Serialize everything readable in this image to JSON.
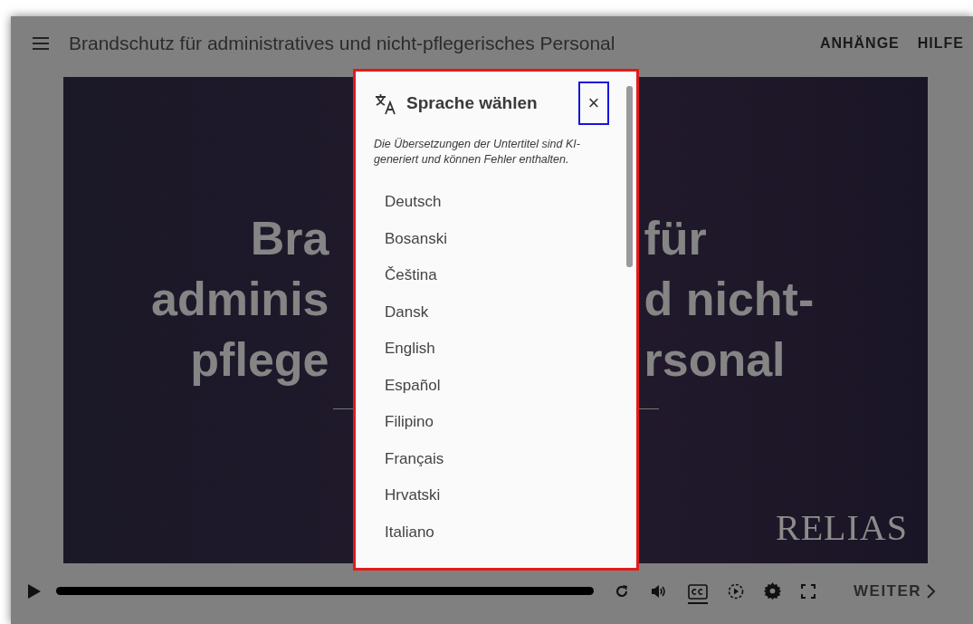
{
  "header": {
    "title": "Brandschutz für administratives und nicht-pflegerisches Personal",
    "links": [
      "ANHÄNGE",
      "HILFE"
    ]
  },
  "slide": {
    "title_lines": [
      {
        "left": "Bra",
        "right": "für"
      },
      {
        "left": "adminis",
        "right": "d nicht-"
      },
      {
        "left": "pflege",
        "right": "rsonal"
      }
    ],
    "logo": "RELIAS"
  },
  "dialog": {
    "title": "Sprache wählen",
    "note": "Die Übersetzungen der Untertitel sind KI-generiert und können Fehler enthalten.",
    "close": "×",
    "languages": [
      {
        "label": "Deutsch"
      },
      {
        "label": "Bosanski"
      },
      {
        "label": "Čeština"
      },
      {
        "label": "Dansk"
      },
      {
        "label": "English"
      },
      {
        "label": "Español"
      },
      {
        "label": "Filipino"
      },
      {
        "label": "Français"
      },
      {
        "label": "Hrvatski"
      },
      {
        "label": "Italiano"
      }
    ]
  },
  "player": {
    "progress": {
      "level": 1
    },
    "captions_on": true,
    "next_label": "WEITER"
  }
}
